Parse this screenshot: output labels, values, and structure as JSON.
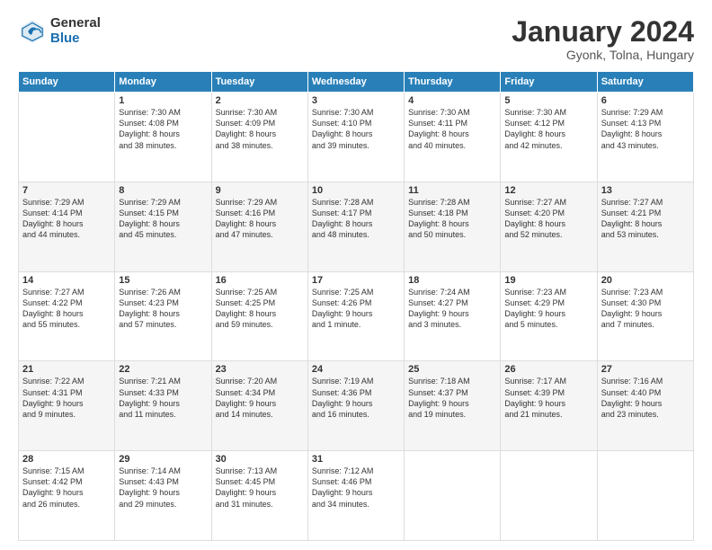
{
  "logo": {
    "general": "General",
    "blue": "Blue"
  },
  "title": "January 2024",
  "location": "Gyonk, Tolna, Hungary",
  "days_header": [
    "Sunday",
    "Monday",
    "Tuesday",
    "Wednesday",
    "Thursday",
    "Friday",
    "Saturday"
  ],
  "weeks": [
    [
      {
        "day": "",
        "info": ""
      },
      {
        "day": "1",
        "info": "Sunrise: 7:30 AM\nSunset: 4:08 PM\nDaylight: 8 hours\nand 38 minutes."
      },
      {
        "day": "2",
        "info": "Sunrise: 7:30 AM\nSunset: 4:09 PM\nDaylight: 8 hours\nand 38 minutes."
      },
      {
        "day": "3",
        "info": "Sunrise: 7:30 AM\nSunset: 4:10 PM\nDaylight: 8 hours\nand 39 minutes."
      },
      {
        "day": "4",
        "info": "Sunrise: 7:30 AM\nSunset: 4:11 PM\nDaylight: 8 hours\nand 40 minutes."
      },
      {
        "day": "5",
        "info": "Sunrise: 7:30 AM\nSunset: 4:12 PM\nDaylight: 8 hours\nand 42 minutes."
      },
      {
        "day": "6",
        "info": "Sunrise: 7:29 AM\nSunset: 4:13 PM\nDaylight: 8 hours\nand 43 minutes."
      }
    ],
    [
      {
        "day": "7",
        "info": "Sunrise: 7:29 AM\nSunset: 4:14 PM\nDaylight: 8 hours\nand 44 minutes."
      },
      {
        "day": "8",
        "info": "Sunrise: 7:29 AM\nSunset: 4:15 PM\nDaylight: 8 hours\nand 45 minutes."
      },
      {
        "day": "9",
        "info": "Sunrise: 7:29 AM\nSunset: 4:16 PM\nDaylight: 8 hours\nand 47 minutes."
      },
      {
        "day": "10",
        "info": "Sunrise: 7:28 AM\nSunset: 4:17 PM\nDaylight: 8 hours\nand 48 minutes."
      },
      {
        "day": "11",
        "info": "Sunrise: 7:28 AM\nSunset: 4:18 PM\nDaylight: 8 hours\nand 50 minutes."
      },
      {
        "day": "12",
        "info": "Sunrise: 7:27 AM\nSunset: 4:20 PM\nDaylight: 8 hours\nand 52 minutes."
      },
      {
        "day": "13",
        "info": "Sunrise: 7:27 AM\nSunset: 4:21 PM\nDaylight: 8 hours\nand 53 minutes."
      }
    ],
    [
      {
        "day": "14",
        "info": "Sunrise: 7:27 AM\nSunset: 4:22 PM\nDaylight: 8 hours\nand 55 minutes."
      },
      {
        "day": "15",
        "info": "Sunrise: 7:26 AM\nSunset: 4:23 PM\nDaylight: 8 hours\nand 57 minutes."
      },
      {
        "day": "16",
        "info": "Sunrise: 7:25 AM\nSunset: 4:25 PM\nDaylight: 8 hours\nand 59 minutes."
      },
      {
        "day": "17",
        "info": "Sunrise: 7:25 AM\nSunset: 4:26 PM\nDaylight: 9 hours\nand 1 minute."
      },
      {
        "day": "18",
        "info": "Sunrise: 7:24 AM\nSunset: 4:27 PM\nDaylight: 9 hours\nand 3 minutes."
      },
      {
        "day": "19",
        "info": "Sunrise: 7:23 AM\nSunset: 4:29 PM\nDaylight: 9 hours\nand 5 minutes."
      },
      {
        "day": "20",
        "info": "Sunrise: 7:23 AM\nSunset: 4:30 PM\nDaylight: 9 hours\nand 7 minutes."
      }
    ],
    [
      {
        "day": "21",
        "info": "Sunrise: 7:22 AM\nSunset: 4:31 PM\nDaylight: 9 hours\nand 9 minutes."
      },
      {
        "day": "22",
        "info": "Sunrise: 7:21 AM\nSunset: 4:33 PM\nDaylight: 9 hours\nand 11 minutes."
      },
      {
        "day": "23",
        "info": "Sunrise: 7:20 AM\nSunset: 4:34 PM\nDaylight: 9 hours\nand 14 minutes."
      },
      {
        "day": "24",
        "info": "Sunrise: 7:19 AM\nSunset: 4:36 PM\nDaylight: 9 hours\nand 16 minutes."
      },
      {
        "day": "25",
        "info": "Sunrise: 7:18 AM\nSunset: 4:37 PM\nDaylight: 9 hours\nand 19 minutes."
      },
      {
        "day": "26",
        "info": "Sunrise: 7:17 AM\nSunset: 4:39 PM\nDaylight: 9 hours\nand 21 minutes."
      },
      {
        "day": "27",
        "info": "Sunrise: 7:16 AM\nSunset: 4:40 PM\nDaylight: 9 hours\nand 23 minutes."
      }
    ],
    [
      {
        "day": "28",
        "info": "Sunrise: 7:15 AM\nSunset: 4:42 PM\nDaylight: 9 hours\nand 26 minutes."
      },
      {
        "day": "29",
        "info": "Sunrise: 7:14 AM\nSunset: 4:43 PM\nDaylight: 9 hours\nand 29 minutes."
      },
      {
        "day": "30",
        "info": "Sunrise: 7:13 AM\nSunset: 4:45 PM\nDaylight: 9 hours\nand 31 minutes."
      },
      {
        "day": "31",
        "info": "Sunrise: 7:12 AM\nSunset: 4:46 PM\nDaylight: 9 hours\nand 34 minutes."
      },
      {
        "day": "",
        "info": ""
      },
      {
        "day": "",
        "info": ""
      },
      {
        "day": "",
        "info": ""
      }
    ]
  ]
}
